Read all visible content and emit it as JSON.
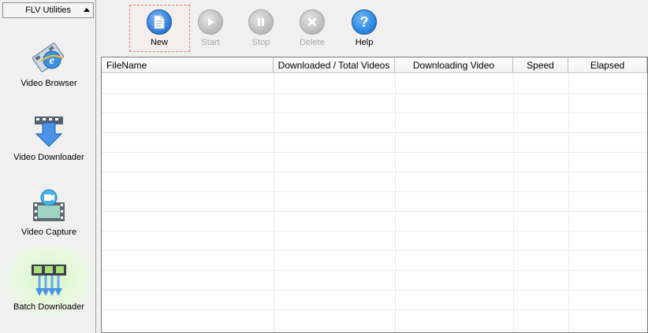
{
  "sidebar": {
    "header": "FLV Utilities",
    "items": [
      {
        "label": "Video Browser",
        "icon": "video-browser-icon"
      },
      {
        "label": "Video Downloader",
        "icon": "video-downloader-icon"
      },
      {
        "label": "Video Capture",
        "icon": "video-capture-icon"
      },
      {
        "label": "Batch Downloader",
        "icon": "batch-downloader-icon"
      }
    ]
  },
  "toolbar": {
    "new_label": "New",
    "start_label": "Start",
    "stop_label": "Stop",
    "delete_label": "Delete",
    "help_label": "Help"
  },
  "table": {
    "columns": [
      "FileName",
      "Downloaded / Total Videos",
      "Downloading Video",
      "Speed",
      "Elapsed"
    ],
    "rows": []
  },
  "colors": {
    "accent_blue": "#2f7fd8",
    "disabled_gray": "#b9b9b9",
    "active_glow": "#c8f2b0"
  }
}
